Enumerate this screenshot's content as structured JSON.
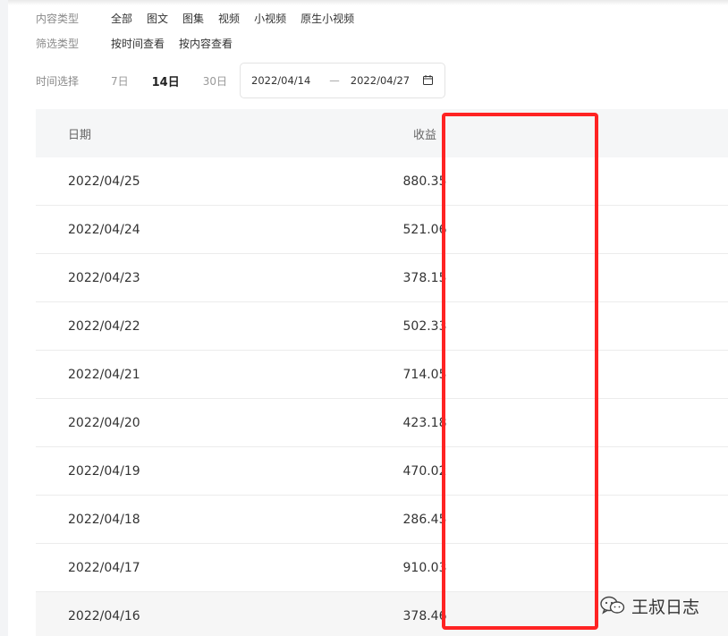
{
  "filters": {
    "content_type": {
      "label": "内容类型",
      "options": [
        "全部",
        "图文",
        "图集",
        "视频",
        "小视频",
        "原生小视频"
      ]
    },
    "filter_type": {
      "label": "筛选类型",
      "options": [
        "按时间查看",
        "按内容查看"
      ]
    },
    "time_select": {
      "label": "时间选择",
      "options": [
        "7日",
        "14日",
        "30日"
      ],
      "selected": "14日"
    },
    "date_range": {
      "start": "2022/04/14",
      "end": "2022/04/27",
      "separator": "—"
    }
  },
  "table": {
    "headers": {
      "date": "日期",
      "income": "收益"
    },
    "rows": [
      {
        "date": "2022/04/25",
        "income": "880.35"
      },
      {
        "date": "2022/04/24",
        "income": "521.06"
      },
      {
        "date": "2022/04/23",
        "income": "378.15"
      },
      {
        "date": "2022/04/22",
        "income": "502.33"
      },
      {
        "date": "2022/04/21",
        "income": "714.05"
      },
      {
        "date": "2022/04/20",
        "income": "423.18"
      },
      {
        "date": "2022/04/19",
        "income": "470.02"
      },
      {
        "date": "2022/04/18",
        "income": "286.45"
      },
      {
        "date": "2022/04/17",
        "income": "910.03"
      },
      {
        "date": "2022/04/16",
        "income": "378.46"
      }
    ]
  },
  "highlight": {
    "color": "#ff2323"
  },
  "watermark": {
    "text": "王叔日志",
    "icon": "wechat-icon"
  }
}
